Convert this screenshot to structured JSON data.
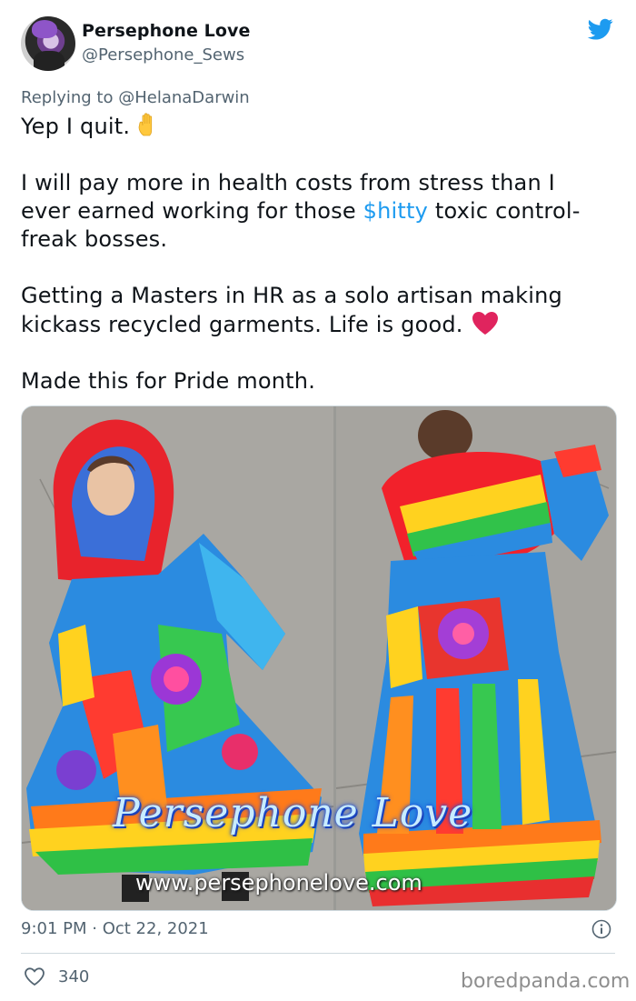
{
  "colors": {
    "link": "#1d9bf0",
    "secondary": "#536471",
    "heart": "#e0245e",
    "twitter_blue": "#1d9bf0"
  },
  "user": {
    "name": "Persephone Love",
    "handle": "@Persephone_Sews"
  },
  "reply": {
    "prefix": "Replying to",
    "mention": "@HelanaDarwin"
  },
  "tweet": {
    "line1": "Yep I quit.",
    "para2_pre": "I will pay more in health costs from stress than I ever earned working for those",
    "para2_link": "$hitty",
    "para2_post": "toxic control-freak bosses.",
    "para3": "Getting a Masters in HR as a solo artisan making kickass recycled garments. Life is good.",
    "para4": "Made this for Pride month."
  },
  "media": {
    "watermark_name": "Persephone Love",
    "watermark_url": "www.persephonelove.com"
  },
  "meta": {
    "timestamp": "9:01 PM · Oct 22, 2021"
  },
  "actions": {
    "likes": "340"
  },
  "site_watermark": "boredpanda.com",
  "icons": {
    "logo": "twitter-bird-icon",
    "raised_hand": "raised-hand-emoji",
    "heart": "red-heart-emoji",
    "info": "info-icon",
    "like": "heart-outline-icon"
  }
}
